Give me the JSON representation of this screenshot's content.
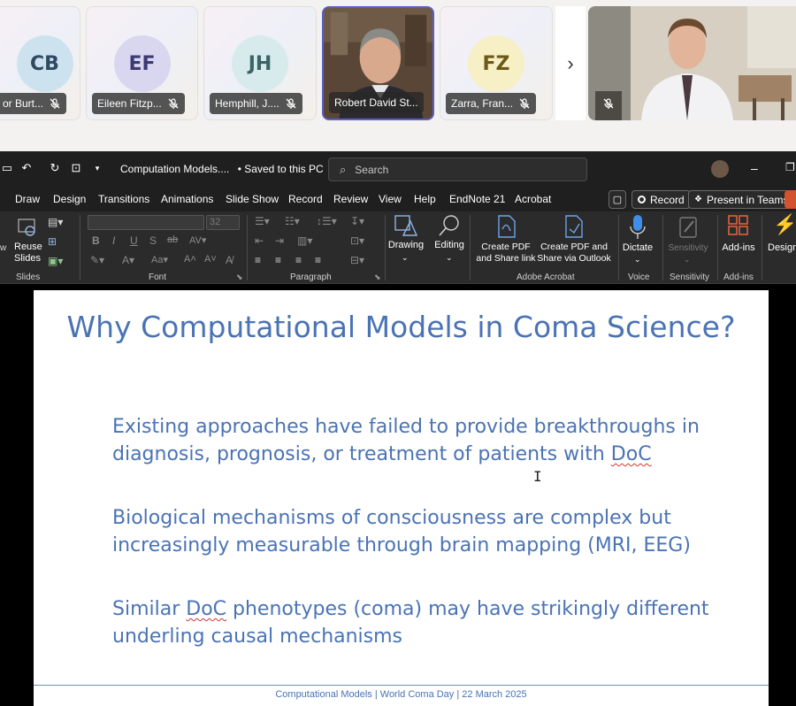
{
  "participants": [
    {
      "initials": "CB",
      "name": "or Burt...",
      "avatar_bg": "#cde2ef",
      "avatar_fg": "#2e4a63"
    },
    {
      "initials": "EF",
      "name": "Eileen Fitzp...",
      "avatar_bg": "#d9d7ef",
      "avatar_fg": "#3d3a73"
    },
    {
      "initials": "JH",
      "name": "Hemphill, J....",
      "avatar_bg": "#d7ebec",
      "avatar_fg": "#3a6466"
    },
    {
      "name": "Robert David St..."
    },
    {
      "initials": "FZ",
      "name": "Zarra, Fran...",
      "avatar_bg": "#f7efc6",
      "avatar_fg": "#6b5a16"
    }
  ],
  "strip_next": "›",
  "titlebar": {
    "document": "Computation Models....",
    "save_status": "• Saved to this PC",
    "search_placeholder": "Search"
  },
  "tabs": [
    "Draw",
    "Design",
    "Transitions",
    "Animations",
    "Slide Show",
    "Record",
    "Review",
    "View",
    "Help",
    "EndNote 21",
    "Acrobat"
  ],
  "tab_buttons": {
    "record": "Record",
    "present": "Present in Teams"
  },
  "ribbon": {
    "reuse_slides": "Reuse Slides",
    "font_size": "32",
    "drawing": "Drawing",
    "editing": "Editing",
    "create_pdf_share": "Create PDF and Share link",
    "create_pdf_outlook": "Create PDF and Share via Outlook",
    "dictate": "Dictate",
    "sensitivity": "Sensitivity",
    "addins": "Add-ins",
    "designer": "Design",
    "groups": {
      "slides": "Slides",
      "font": "Font",
      "paragraph": "Paragraph",
      "adobe": "Adobe Acrobat",
      "voice": "Voice",
      "sensitivity": "Sensitivity",
      "addins": "Add-ins"
    }
  },
  "slide": {
    "title": "Why Computational Models in Coma Science?",
    "bullet1_a": "Existing approaches have failed to provide breakthroughs in diagnosis, prognosis, or treatment of patients with ",
    "bullet1_b": "DoC",
    "bullet2": "Biological mechanisms of consciousness are complex but increasingly measurable through brain mapping (MRI, EEG)",
    "bullet3_a": "Similar ",
    "bullet3_b": "DoC",
    "bullet3_c": " phenotypes (coma) may have strikingly different underling causal mechanisms",
    "footer": "Computational Models  |  World Coma Day  |  22 March 2025"
  }
}
